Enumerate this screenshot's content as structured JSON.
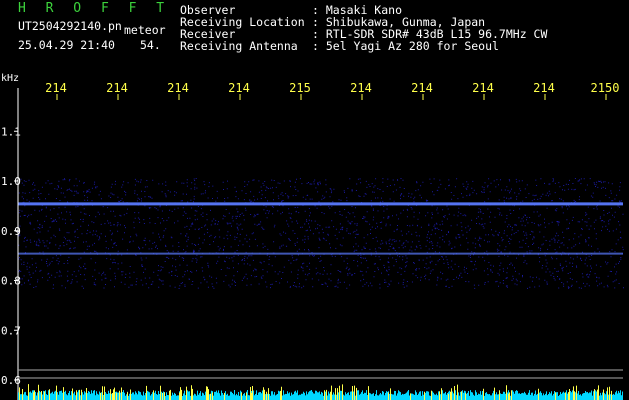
{
  "header": {
    "title": "H R O F F T",
    "filename": "UT2504292140.pn",
    "meteor_label": "meteor",
    "datetime": "25.04.29 21:40",
    "count": "54."
  },
  "info": [
    {
      "key": "Observer",
      "value": ": Masaki Kano"
    },
    {
      "key": "Receiving Location",
      "value": ": Shibukawa, Gunma, Japan"
    },
    {
      "key": "Receiver",
      "value": ": RTL-SDR SDR# 43dB L15 96.7MHz CW"
    },
    {
      "key": "Receiving Antenna",
      "value": ": 5el Yagi Az 280 for Seoul"
    }
  ],
  "chart_data": {
    "type": "heatmap",
    "ylabel": "kHz",
    "y_ticks": [
      "1.1",
      "1.0",
      "0.9",
      "0.8",
      "0.7",
      "0.6"
    ],
    "y_tick_values": [
      1.1,
      1.0,
      0.9,
      0.8,
      0.7,
      0.6
    ],
    "ylim": [
      0.58,
      1.16
    ],
    "x_ticks": [
      "214",
      "214",
      "214",
      "214",
      "215",
      "214",
      "214",
      "214",
      "214",
      "2150"
    ],
    "signal_lines_khz": [
      0.954,
      0.853
    ],
    "colors": {
      "axis": "#ffffff",
      "noise": "#2020c8",
      "signal": "#5a7aff",
      "power": "#00d8ff",
      "peaks": "#ffff4a",
      "text": "#ffffff",
      "ticks": "#ffff4a",
      "title": "#3cd23c"
    }
  }
}
